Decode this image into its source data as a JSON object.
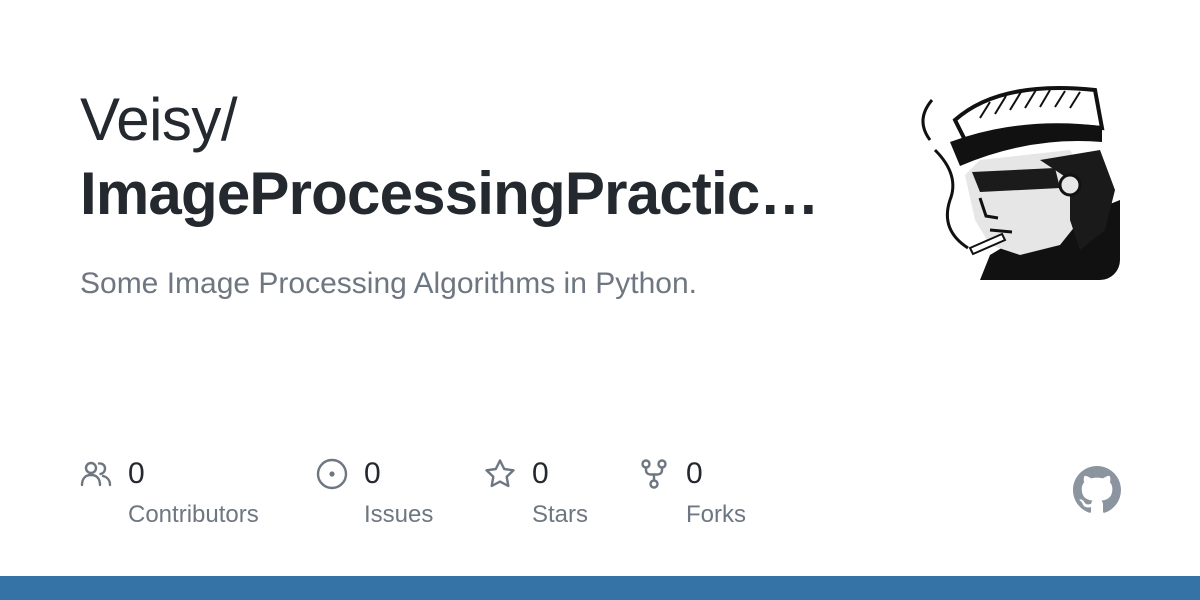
{
  "repo": {
    "owner": "Veisy/",
    "name": "ImageProcessingPractic…",
    "description": "Some Image Processing Algorithms in Python."
  },
  "avatar": {
    "icon": "user-avatar-icon"
  },
  "stats": {
    "contributors": {
      "count": "0",
      "label": "Contributors",
      "icon": "people-icon"
    },
    "issues": {
      "count": "0",
      "label": "Issues",
      "icon": "issue-opened-icon"
    },
    "stars": {
      "count": "0",
      "label": "Stars",
      "icon": "star-icon"
    },
    "forks": {
      "count": "0",
      "label": "Forks",
      "icon": "repo-forked-icon"
    }
  },
  "brand": {
    "logo": "github-logo-icon",
    "language_color": "#3572a5",
    "logo_color": "#8c959f"
  }
}
